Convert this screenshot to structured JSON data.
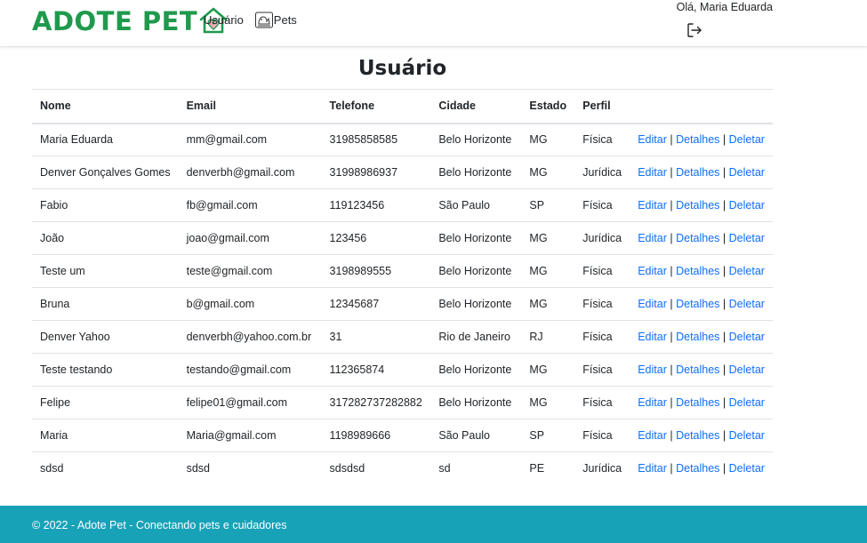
{
  "navbar": {
    "brand": "ADOTE PET",
    "links": [
      {
        "label": "Usuário"
      },
      {
        "label": "Pets"
      }
    ],
    "greeting": "Olá, Maria Eduarda",
    "brand_color": "#1f9a4d"
  },
  "main": {
    "title": "Usuário",
    "columns": [
      "Nome",
      "Email",
      "Telefone",
      "Cidade",
      "Estado",
      "Perfil",
      ""
    ],
    "actions": {
      "edit": "Editar",
      "details": "Detalhes",
      "delete": "Deletar",
      "separator": "|"
    },
    "link_color": "#0d6efd",
    "rows": [
      [
        "Maria Eduarda",
        "mm@gmail.com",
        "31985858585",
        "Belo Horizonte",
        "MG",
        "Física"
      ],
      [
        "Denver Gonçalves Gomes",
        "denverbh@gmail.com",
        "31998986937",
        "Belo Horizonte",
        "MG",
        "Jurídica"
      ],
      [
        "Fabio",
        "fb@gmail.com",
        "119123456",
        "São Paulo",
        "SP",
        "Física"
      ],
      [
        "João",
        "joao@gmail.com",
        "123456",
        "Belo Horizonte",
        "MG",
        "Jurídica"
      ],
      [
        "Teste um",
        "teste@gmail.com",
        "3198989555",
        "Belo Horizonte",
        "MG",
        "Física"
      ],
      [
        "Bruna",
        "b@gmail.com",
        "12345687",
        "Belo Horizonte",
        "MG",
        "Física"
      ],
      [
        "Denver Yahoo",
        "denverbh@yahoo.com.br",
        "31",
        "Rio de Janeiro",
        "RJ",
        "Física"
      ],
      [
        "Teste testando",
        "testando@gmail.com",
        "112365874",
        "Belo Horizonte",
        "MG",
        "Física"
      ],
      [
        "Felipe",
        "felipe01@gmail.com",
        "317282737282882",
        "Belo Horizonte",
        "MG",
        "Física"
      ],
      [
        "Maria",
        "Maria@gmail.com",
        "1198989666",
        "São Paulo",
        "SP",
        "Física"
      ],
      [
        "sdsd",
        "sdsd",
        "sdsdsd",
        "sd",
        "PE",
        "Jurídica"
      ]
    ]
  },
  "footer": {
    "text": "© 2022 - Adote Pet - Conectando pets e cuidadores",
    "color": "#17a2b8"
  },
  "icons": [
    "house-heart-logo-icon",
    "pets-icon",
    "logout-icon"
  ]
}
